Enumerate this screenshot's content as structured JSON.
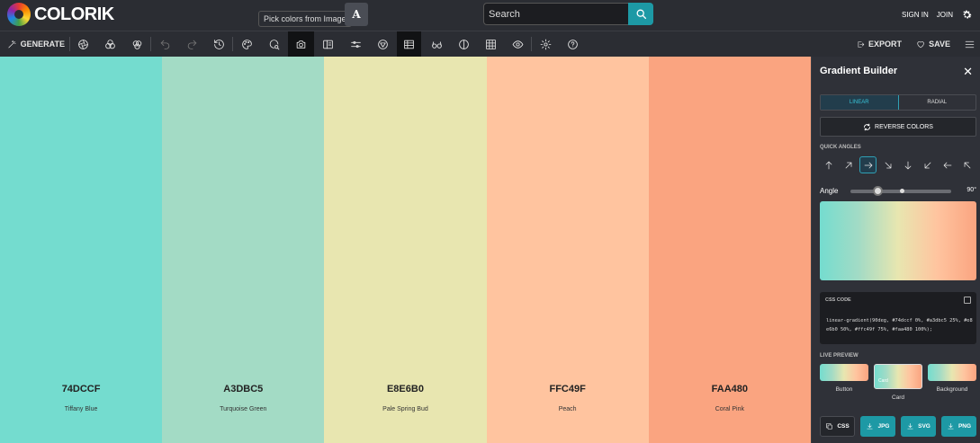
{
  "app": {
    "name": "COLORIK"
  },
  "tooltip": "Pick colors from Image",
  "font_button": "A",
  "search": {
    "placeholder": "Search"
  },
  "auth": {
    "signin": "SIGN IN",
    "join": "JOIN"
  },
  "toolbar": {
    "generate": "GENERATE",
    "export": "EXPORT",
    "save": "SAVE"
  },
  "colors": [
    {
      "hex": "74DCCF",
      "name": "Tiffany Blue",
      "color": "#74dccf"
    },
    {
      "hex": "A3DBC5",
      "name": "Turquoise Green",
      "color": "#a3dbc5"
    },
    {
      "hex": "E8E6B0",
      "name": "Pale Spring Bud",
      "color": "#e8e6b0"
    },
    {
      "hex": "FFC49F",
      "name": "Peach",
      "color": "#ffc49f"
    },
    {
      "hex": "FAA480",
      "name": "Coral Pink",
      "color": "#faa480"
    }
  ],
  "panel": {
    "title": "Gradient Builder",
    "tabs": {
      "linear": "LINEAR",
      "radial": "RADIAL"
    },
    "reverse": "REVERSE COLORS",
    "quick_angles": "QUICK ANGLES",
    "angle_label": "Angle",
    "angle_value": "90°",
    "css_code_label": "CSS CODE",
    "css_code": "linear-gradient(90deg, #74dccf 0%, #a3dbc5 25%, #e8e6b0 50%, #ffc49f 75%, #faa480 100%);",
    "live_preview": "LIVE PREVIEW",
    "preview": {
      "button": "Button",
      "card": "Card",
      "card_inner": "Card",
      "background": "Background"
    },
    "exports": {
      "css": "CSS",
      "jpg": "JPG",
      "svg": "SVG",
      "png": "PNG"
    }
  },
  "accent": "#1d99a5"
}
